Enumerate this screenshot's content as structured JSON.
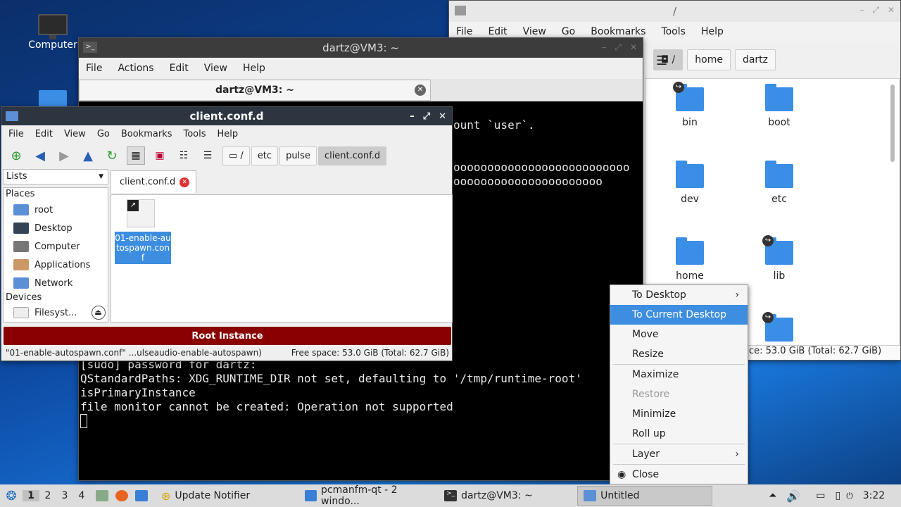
{
  "desktop": {
    "computer_label": "Computer"
  },
  "fm_right": {
    "title": "/",
    "menu": [
      "File",
      "Edit",
      "View",
      "Go",
      "Bookmarks",
      "Tools",
      "Help"
    ],
    "path": [
      "/",
      "home",
      "dartz"
    ],
    "items": [
      "bin",
      "boot",
      "dev",
      "etc",
      "home",
      "lib",
      ""
    ],
    "status": "ace: 53.0 GiB (Total: 62.7 GiB)"
  },
  "terminal": {
    "title": "dartz@VM3: ~",
    "menu": [
      "File",
      "Actions",
      "Edit",
      "View",
      "Help"
    ],
    "tab_label": "dartz@VM3: ~",
    "lines": [
      "ount `user`.",
      "oooooooooooooooooooooooooo",
      "oooooooooooooooooooooo",
      "[sudo] password for dartz:",
      "QStandardPaths: XDG_RUNTIME_DIR not set, defaulting to '/tmp/runtime-root'",
      "isPrimaryInstance",
      "file monitor cannot be created: Operation not supported"
    ]
  },
  "fm_left": {
    "title": "client.conf.d",
    "menu": [
      "File",
      "Edit",
      "View",
      "Go",
      "Bookmarks",
      "Tools",
      "Help"
    ],
    "path": [
      "/",
      "etc",
      "pulse",
      "client.conf.d"
    ],
    "side_mode": "Lists",
    "places_header": "Places",
    "places": [
      "root",
      "Desktop",
      "Computer",
      "Applications",
      "Network"
    ],
    "devices_header": "Devices",
    "devices": [
      "Filesyst..."
    ],
    "tab": "client.conf.d",
    "file": "01-enable-autospawn.conf",
    "root_banner": "Root Instance",
    "status_left": "\"01-enable-autospawn.conf\" ...ulseaudio-enable-autospawn)",
    "status_right": "Free space: 53.0 GiB (Total: 62.7 GiB)"
  },
  "context_menu": {
    "items": [
      "To Desktop",
      "To Current Desktop",
      "Move",
      "Resize",
      "Maximize",
      "Restore",
      "Minimize",
      "Roll up",
      "Layer",
      "Close"
    ]
  },
  "taskbar": {
    "workspaces": [
      "1",
      "2",
      "3",
      "4"
    ],
    "tasks": [
      "Update Notifier",
      "pcmanfm-qt - 2 windo...",
      "dartz@VM3: ~",
      "Untitled"
    ],
    "clock": "3:22"
  }
}
